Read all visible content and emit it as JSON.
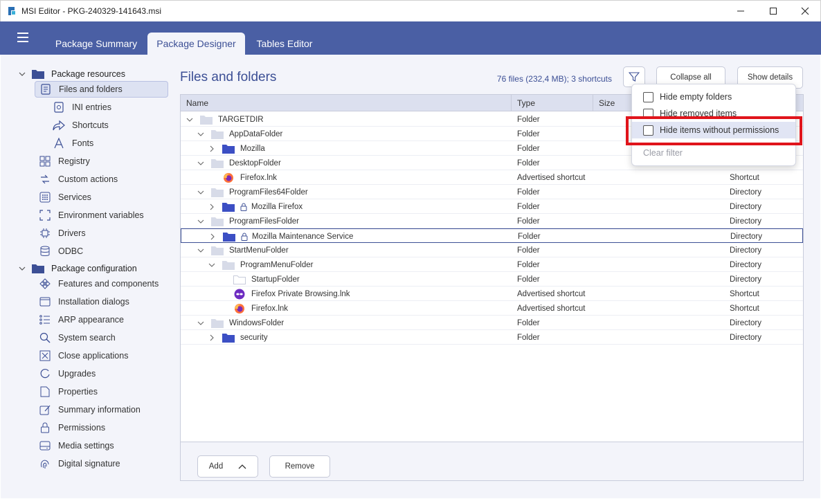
{
  "window": {
    "title": "MSI Editor - PKG-240329-141643.msi",
    "controls": [
      "minimize-icon",
      "maximize-icon",
      "close-icon"
    ]
  },
  "header": {
    "tabs": [
      {
        "label": "Package Summary",
        "active": false
      },
      {
        "label": "Package Designer",
        "active": true
      },
      {
        "label": "Tables Editor",
        "active": false
      }
    ]
  },
  "sidebar": {
    "groups": [
      {
        "label": "Package resources",
        "items": [
          {
            "label": "Files and folders",
            "icon": "file-icon",
            "selected": true
          },
          {
            "label": "INI entries",
            "icon": "ini-icon"
          },
          {
            "label": "Shortcuts",
            "icon": "shortcut-icon"
          },
          {
            "label": "Fonts",
            "icon": "font-icon"
          },
          {
            "label": "Registry",
            "icon": "registry-icon"
          },
          {
            "label": "Custom actions",
            "icon": "custom-action-icon"
          },
          {
            "label": "Services",
            "icon": "services-icon"
          },
          {
            "label": "Environment variables",
            "icon": "environment-icon"
          },
          {
            "label": "Drivers",
            "icon": "driver-icon"
          },
          {
            "label": "ODBC",
            "icon": "database-icon"
          }
        ]
      },
      {
        "label": "Package configuration",
        "items": [
          {
            "label": "Features and components",
            "icon": "features-icon"
          },
          {
            "label": "Installation dialogs",
            "icon": "dialog-icon"
          },
          {
            "label": "ARP appearance",
            "icon": "list-icon"
          },
          {
            "label": "System search",
            "icon": "search-icon"
          },
          {
            "label": "Close applications",
            "icon": "close-app-icon"
          },
          {
            "label": "Upgrades",
            "icon": "upgrade-icon"
          },
          {
            "label": "Properties",
            "icon": "properties-icon"
          },
          {
            "label": "Summary information",
            "icon": "summary-icon"
          },
          {
            "label": "Permissions",
            "icon": "lock-icon"
          },
          {
            "label": "Media settings",
            "icon": "media-icon"
          },
          {
            "label": "Digital signature",
            "icon": "fingerprint-icon"
          }
        ]
      }
    ]
  },
  "main": {
    "title": "Files and folders",
    "summary": "76 files (232,4 MB); 3 shortcuts",
    "collapse_label": "Collapse all",
    "details_label": "Show details",
    "columns": [
      "Name",
      "Type",
      "Size",
      ""
    ],
    "rows": [
      {
        "name": "TARGETDIR",
        "type": "Folder",
        "kind": "",
        "indent": 0,
        "chevron": "down",
        "icon": "folder-light",
        "lock": false
      },
      {
        "name": "AppDataFolder",
        "type": "Folder",
        "kind": "",
        "indent": 1,
        "chevron": "down",
        "icon": "folder-light",
        "lock": false
      },
      {
        "name": "Mozilla",
        "type": "Folder",
        "kind": "",
        "indent": 2,
        "chevron": "right",
        "icon": "folder-blue",
        "lock": false
      },
      {
        "name": "DesktopFolder",
        "type": "Folder",
        "kind": "",
        "indent": 1,
        "chevron": "down",
        "icon": "folder-light",
        "lock": false
      },
      {
        "name": "Firefox.lnk",
        "type": "Advertised shortcut",
        "kind": "Shortcut",
        "indent": 2,
        "chevron": "none",
        "icon": "firefox",
        "lock": false
      },
      {
        "name": "ProgramFiles64Folder",
        "type": "Folder",
        "kind": "Directory",
        "indent": 1,
        "chevron": "down",
        "icon": "folder-light",
        "lock": false
      },
      {
        "name": "Mozilla Firefox",
        "type": "Folder",
        "kind": "Directory",
        "indent": 2,
        "chevron": "right",
        "icon": "folder-blue",
        "lock": true
      },
      {
        "name": "ProgramFilesFolder",
        "type": "Folder",
        "kind": "Directory",
        "indent": 1,
        "chevron": "down",
        "icon": "folder-light",
        "lock": false
      },
      {
        "name": "Mozilla Maintenance Service",
        "type": "Folder",
        "kind": "Directory",
        "indent": 2,
        "chevron": "right",
        "icon": "folder-blue",
        "lock": true,
        "selected": true
      },
      {
        "name": "StartMenuFolder",
        "type": "Folder",
        "kind": "Directory",
        "indent": 1,
        "chevron": "down",
        "icon": "folder-light",
        "lock": false
      },
      {
        "name": "ProgramMenuFolder",
        "type": "Folder",
        "kind": "Directory",
        "indent": 2,
        "chevron": "down",
        "icon": "folder-light",
        "lock": false
      },
      {
        "name": "StartupFolder",
        "type": "Folder",
        "kind": "Directory",
        "indent": 3,
        "chevron": "none",
        "icon": "folder-outline",
        "lock": false
      },
      {
        "name": "Firefox Private Browsing.lnk",
        "type": "Advertised shortcut",
        "kind": "Shortcut",
        "indent": 3,
        "chevron": "none",
        "icon": "private-browsing",
        "lock": false
      },
      {
        "name": "Firefox.lnk",
        "type": "Advertised shortcut",
        "kind": "Shortcut",
        "indent": 3,
        "chevron": "none",
        "icon": "firefox",
        "lock": false
      },
      {
        "name": "WindowsFolder",
        "type": "Folder",
        "kind": "Directory",
        "indent": 1,
        "chevron": "down",
        "icon": "folder-light",
        "lock": false
      },
      {
        "name": "security",
        "type": "Folder",
        "kind": "Directory",
        "indent": 2,
        "chevron": "right",
        "icon": "folder-blue",
        "lock": false
      }
    ],
    "add_label": "Add",
    "remove_label": "Remove"
  },
  "filter_menu": {
    "items": [
      {
        "label": "Hide empty folders",
        "checked": false
      },
      {
        "label": "Hide removed items",
        "checked": false
      },
      {
        "label": "Hide items without permissions",
        "checked": false,
        "hovered": true
      }
    ],
    "clear_label": "Clear filter"
  },
  "colors": {
    "header": "#4a5fa4",
    "accent": "#3c4f95",
    "panel": "#f3f4fa",
    "highlight": "#e0141b"
  }
}
